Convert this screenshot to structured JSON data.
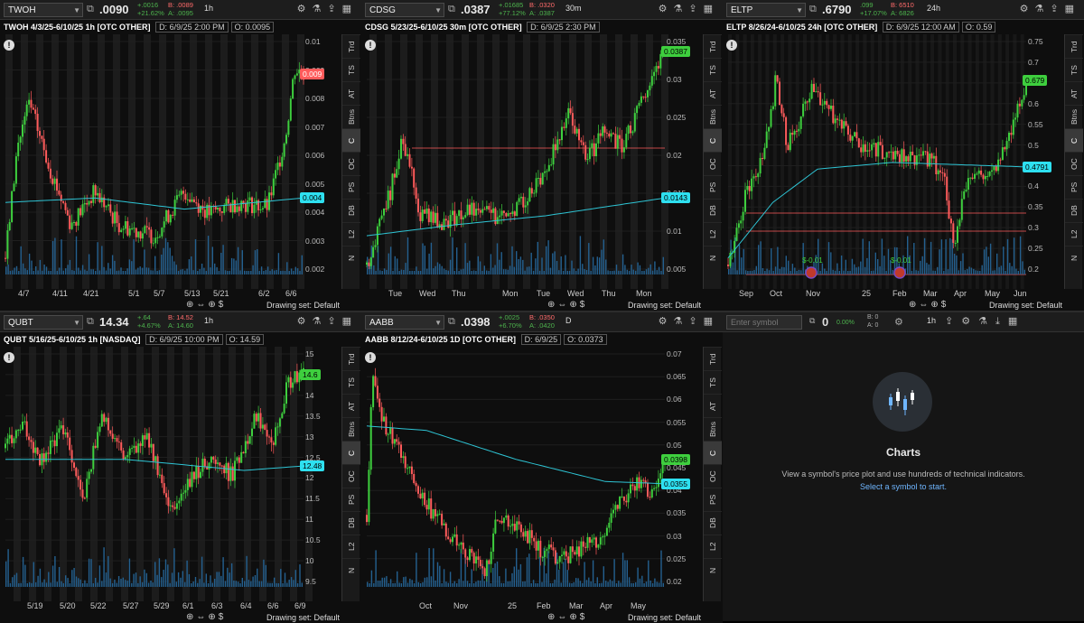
{
  "panels": [
    {
      "symbol": "TWOH",
      "last": ".0090",
      "chg1": "+.0016",
      "chg2": "+21.62%",
      "bid": "B: .0089",
      "ask": "A: .0095",
      "tf": "1h",
      "info": "TWOH 4/3/25-6/10/25 1h [OTC OTHER]",
      "date": "D: 6/9/25 2:00 PM",
      "open": "O: 0.0095",
      "yticks": [
        "0.01",
        "0.009",
        "0.008",
        "0.007",
        "0.006",
        "0.005",
        "0.004",
        "0.003",
        "0.002"
      ],
      "xticks": [
        "4/7",
        "4/11",
        "4/21",
        "5/1",
        "5/7",
        "5/13",
        "5/21",
        "6/2",
        "6/6"
      ],
      "tag_price": "0.009",
      "tag_ma": "0.004",
      "drawing_set": "Drawing set: Default"
    },
    {
      "symbol": "CDSG",
      "last": ".0387",
      "chg1": "+.01685",
      "chg2": "+77.12%",
      "bid": "B: .0320",
      "ask": "A: .0387",
      "tf": "30m",
      "info": "CDSG 5/23/25-6/10/25 30m [OTC OTHER]",
      "date": "D: 6/9/25 2:30 PM",
      "yticks": [
        "0.035",
        "0.03",
        "0.025",
        "0.02",
        "0.015",
        "0.01",
        "0.005"
      ],
      "xticks": [
        "Tue",
        "Wed",
        "Thu",
        "Mon",
        "Tue",
        "Wed",
        "Thu",
        "Mon"
      ],
      "tag_price": "0.0387",
      "tag_ma": "0.0143",
      "drawing_set": "Drawing set: Default"
    },
    {
      "symbol": "ELTP",
      "last": ".6790",
      "chg1": ".099",
      "chg2": "+17.07%",
      "bid": "B: 6510",
      "ask": "A: 6826",
      "tf": "24h",
      "info": "ELTP 8/26/24-6/10/25 24h [OTC OTHER]",
      "date": "D: 6/9/25 12:00 AM",
      "open": "O: 0.59",
      "yticks": [
        "0.75",
        "0.7",
        "0.65",
        "0.6",
        "0.55",
        "0.5",
        "0.45",
        "0.4",
        "0.35",
        "0.3",
        "0.25",
        "0.2"
      ],
      "xticks": [
        "Sep",
        "Oct",
        "Nov",
        "25",
        "Feb",
        "Mar",
        "Apr",
        "May",
        "Jun"
      ],
      "tag_price": "0.679",
      "tag_ma": "0.4791",
      "marker1": "$-0.01",
      "marker2": "$-0.01",
      "drawing_set": "Drawing set: Default"
    },
    {
      "symbol": "QUBT",
      "last": "14.34",
      "chg1": "+.64",
      "chg2": "+4.67%",
      "bid": "B: 14.52",
      "ask": "A: 14.60",
      "tf": "1h",
      "info": "QUBT 5/16/25-6/10/25 1h [NASDAQ]",
      "date": "D: 6/9/25 10:00 PM",
      "open": "O: 14.59",
      "yticks": [
        "15",
        "14.5",
        "14",
        "13.5",
        "13",
        "12.5",
        "12",
        "11.5",
        "11",
        "10.5",
        "10",
        "9.5"
      ],
      "xticks": [
        "5/19",
        "5/20",
        "5/22",
        "5/27",
        "5/29",
        "6/1",
        "6/3",
        "6/4",
        "6/6",
        "6/9"
      ],
      "tag_price": "14.6",
      "tag_ma": "12.48",
      "drawing_set": "Drawing set: Default"
    },
    {
      "symbol": "AABB",
      "last": ".0398",
      "chg1": "+.0025",
      "chg2": "+6.70%",
      "bid": "B: .0350",
      "ask": "A: .0420",
      "tf": "D",
      "info": "AABB 8/12/24-6/10/25 1D [OTC OTHER]",
      "date": "D: 6/9/25",
      "open": "O: 0.0373",
      "yticks": [
        "0.07",
        "0.065",
        "0.06",
        "0.055",
        "0.05",
        "0.045",
        "0.04",
        "0.035",
        "0.03",
        "0.025",
        "0.02"
      ],
      "xticks": [
        "Oct",
        "Nov",
        "25",
        "Feb",
        "Mar",
        "Apr",
        "May"
      ],
      "tag_price": "0.0398",
      "tag_ma": "0.0355",
      "drawing_set": "Drawing set: Default"
    }
  ],
  "sidetabs": [
    "Trd",
    "TS",
    "AT",
    "Btns",
    "C",
    "OC",
    "PS",
    "DB",
    "L2",
    "N"
  ],
  "empty": {
    "placeholder": "Enter symbol",
    "last": "0",
    "pct": "0.00%",
    "bid": "B: 0",
    "ask": "A: 0",
    "tf": "1h",
    "title": "Charts",
    "text": "View a symbol's price plot and use hundreds of technical indicators.",
    "link": "Select a symbol to start."
  },
  "colors": {
    "up": "#3ecf3e",
    "down": "#ff5b5b",
    "ma": "#2ec4d4",
    "volume": "#2a6fa8",
    "price_tag": "#3ecf3e",
    "ma_tag": "#2ee0f0"
  }
}
